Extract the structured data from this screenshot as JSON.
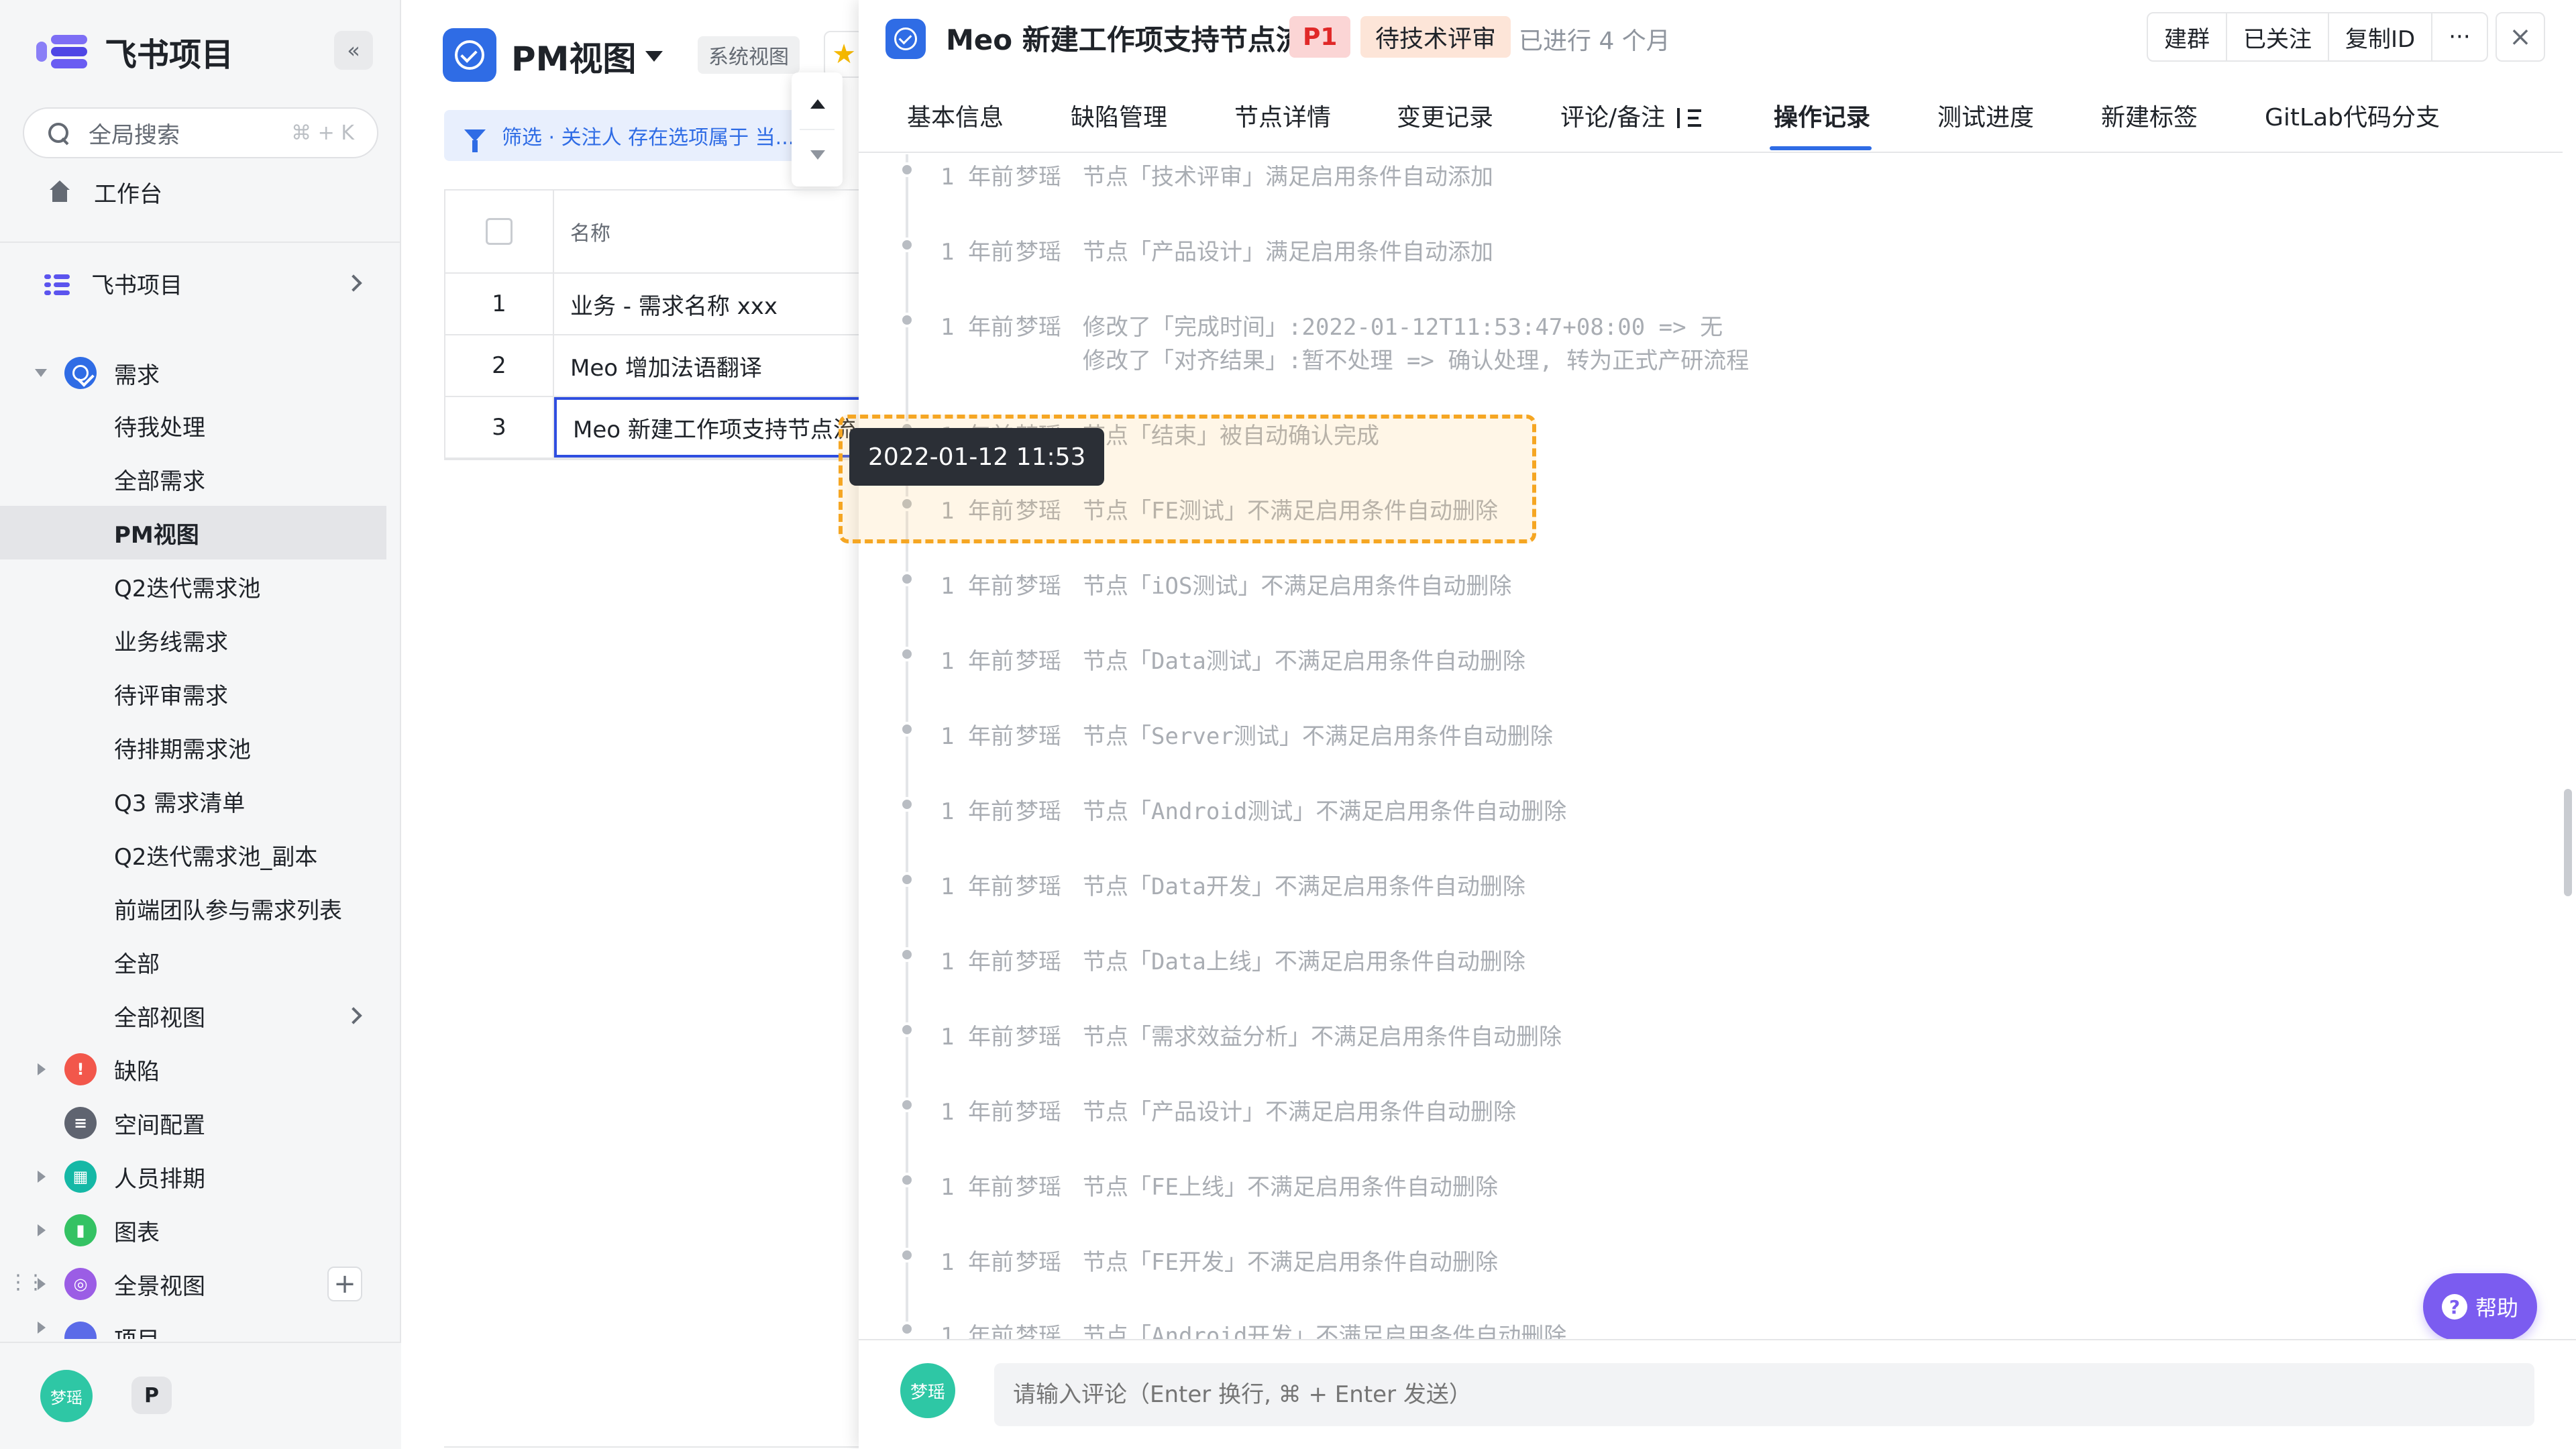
{
  "sidebar": {
    "app_name": "飞书项目",
    "collapse_icon": "«",
    "search": {
      "label": "全局搜索",
      "shortcut": "⌘ + K"
    },
    "workbench": "工作台",
    "project_root": "飞书项目",
    "section_requirements": "需求",
    "requirement_views": [
      "待我处理",
      "全部需求",
      "PM视图",
      "Q2迭代需求池",
      "业务线需求",
      "待评审需求",
      "待排期需求池",
      "Q3 需求清单",
      "Q2迭代需求池_副本",
      "前端团队参与需求列表",
      "全部",
      "全部视图"
    ],
    "selected_view": "PM视图",
    "sections": [
      {
        "label": "缺陷",
        "color": "#f2574b",
        "glyph": "!"
      },
      {
        "label": "空间配置",
        "color": "#5f6470",
        "glyph": "≡"
      },
      {
        "label": "人员排期",
        "color": "#15b8a6",
        "glyph": "▦"
      },
      {
        "label": "图表",
        "color": "#34c263",
        "glyph": "▮"
      },
      {
        "label": "全景视图",
        "color": "#9b5de5",
        "glyph": "◎"
      },
      {
        "label": "项目",
        "color": "#5b6be8",
        "glyph": ""
      }
    ],
    "footer": {
      "avatar_text": "梦瑶",
      "badge": "P"
    }
  },
  "middle": {
    "view_title": "PM视图",
    "system_tag": "系统视图",
    "filter_text": "筛选 · 关注人 存在选项属于 当...",
    "table": {
      "header": "名称",
      "rows": [
        {
          "num": "1",
          "name": "业务 - 需求名称 xxx"
        },
        {
          "num": "2",
          "name": "Meo 增加法语翻译"
        },
        {
          "num": "3",
          "name": "Meo 新建工作项支持节点流"
        }
      ]
    }
  },
  "drawer": {
    "title": "Meo 新建工作项支持节点流",
    "priority": "P1",
    "status": "待技术评审",
    "elapsed": "已进行 4 个月",
    "actions": [
      "建群",
      "已关注",
      "复制ID",
      "···"
    ],
    "close": "×",
    "tabs": [
      "基本信息",
      "缺陷管理",
      "节点详情",
      "变更记录",
      "评论/备注",
      "操作记录",
      "测试进度",
      "新建标签",
      "GitLab代码分支"
    ],
    "active_tab": "操作记录",
    "tooltip": "2022-01-12 11:53",
    "log": [
      {
        "time": "1 年前",
        "user": "梦瑶",
        "lines": [
          "节点「技术评审」满足启用条件自动添加"
        ]
      },
      {
        "time": "1 年前",
        "user": "梦瑶",
        "lines": [
          "节点「产品设计」满足启用条件自动添加"
        ]
      },
      {
        "time": "1 年前",
        "user": "梦瑶",
        "lines": [
          "修改了「完成时间」:2022-01-12T11:53:47+08:00 => 无",
          "修改了「对齐结果」:暂不处理 => 确认处理, 转为正式产研流程"
        ]
      },
      {
        "time": "1 年前",
        "user": "梦瑶",
        "lines": [
          "节点「结束」被自动确认完成"
        ]
      },
      {
        "time": "1 年前",
        "user": "梦瑶",
        "lines": [
          "节点「FE测试」不满足启用条件自动删除"
        ]
      },
      {
        "time": "1 年前",
        "user": "梦瑶",
        "lines": [
          "节点「iOS测试」不满足启用条件自动删除"
        ]
      },
      {
        "time": "1 年前",
        "user": "梦瑶",
        "lines": [
          "节点「Data测试」不满足启用条件自动删除"
        ]
      },
      {
        "time": "1 年前",
        "user": "梦瑶",
        "lines": [
          "节点「Server测试」不满足启用条件自动删除"
        ]
      },
      {
        "time": "1 年前",
        "user": "梦瑶",
        "lines": [
          "节点「Android测试」不满足启用条件自动删除"
        ]
      },
      {
        "time": "1 年前",
        "user": "梦瑶",
        "lines": [
          "节点「Data开发」不满足启用条件自动删除"
        ]
      },
      {
        "time": "1 年前",
        "user": "梦瑶",
        "lines": [
          "节点「Data上线」不满足启用条件自动删除"
        ]
      },
      {
        "time": "1 年前",
        "user": "梦瑶",
        "lines": [
          "节点「需求效益分析」不满足启用条件自动删除"
        ]
      },
      {
        "time": "1 年前",
        "user": "梦瑶",
        "lines": [
          "节点「产品设计」不满足启用条件自动删除"
        ]
      },
      {
        "time": "1 年前",
        "user": "梦瑶",
        "lines": [
          "节点「FE上线」不满足启用条件自动删除"
        ]
      },
      {
        "time": "1 年前",
        "user": "梦瑶",
        "lines": [
          "节点「FE开发」不满足启用条件自动删除"
        ]
      },
      {
        "time": "1 年前",
        "user": "梦瑶",
        "lines": [
          "节点「Android开发」不满足启用条件自动删除"
        ]
      }
    ],
    "help": "帮助",
    "comment": {
      "avatar_text": "梦瑶",
      "placeholder": "请输入评论（Enter 换行, ⌘ + Enter 发送）"
    }
  }
}
